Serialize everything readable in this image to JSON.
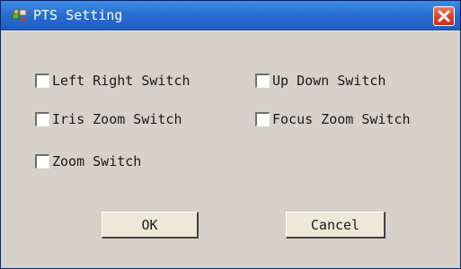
{
  "window": {
    "title": "PTS Setting",
    "title_icon": "network-settings-icon",
    "close_icon": "close-icon"
  },
  "options": {
    "left_right_switch": "Left Right Switch",
    "up_down_switch": "Up Down Switch",
    "iris_zoom_switch": "Iris Zoom Switch",
    "focus_zoom_switch": "Focus Zoom Switch",
    "zoom_switch": "Zoom Switch"
  },
  "checked": {
    "left_right_switch": false,
    "up_down_switch": false,
    "iris_zoom_switch": false,
    "focus_zoom_switch": false,
    "zoom_switch": false
  },
  "buttons": {
    "ok": "OK",
    "cancel": "Cancel"
  },
  "colors": {
    "titlebar": "#2a6fd0",
    "close_button": "#d9432a",
    "dialog_background": "#d6d1c9"
  }
}
